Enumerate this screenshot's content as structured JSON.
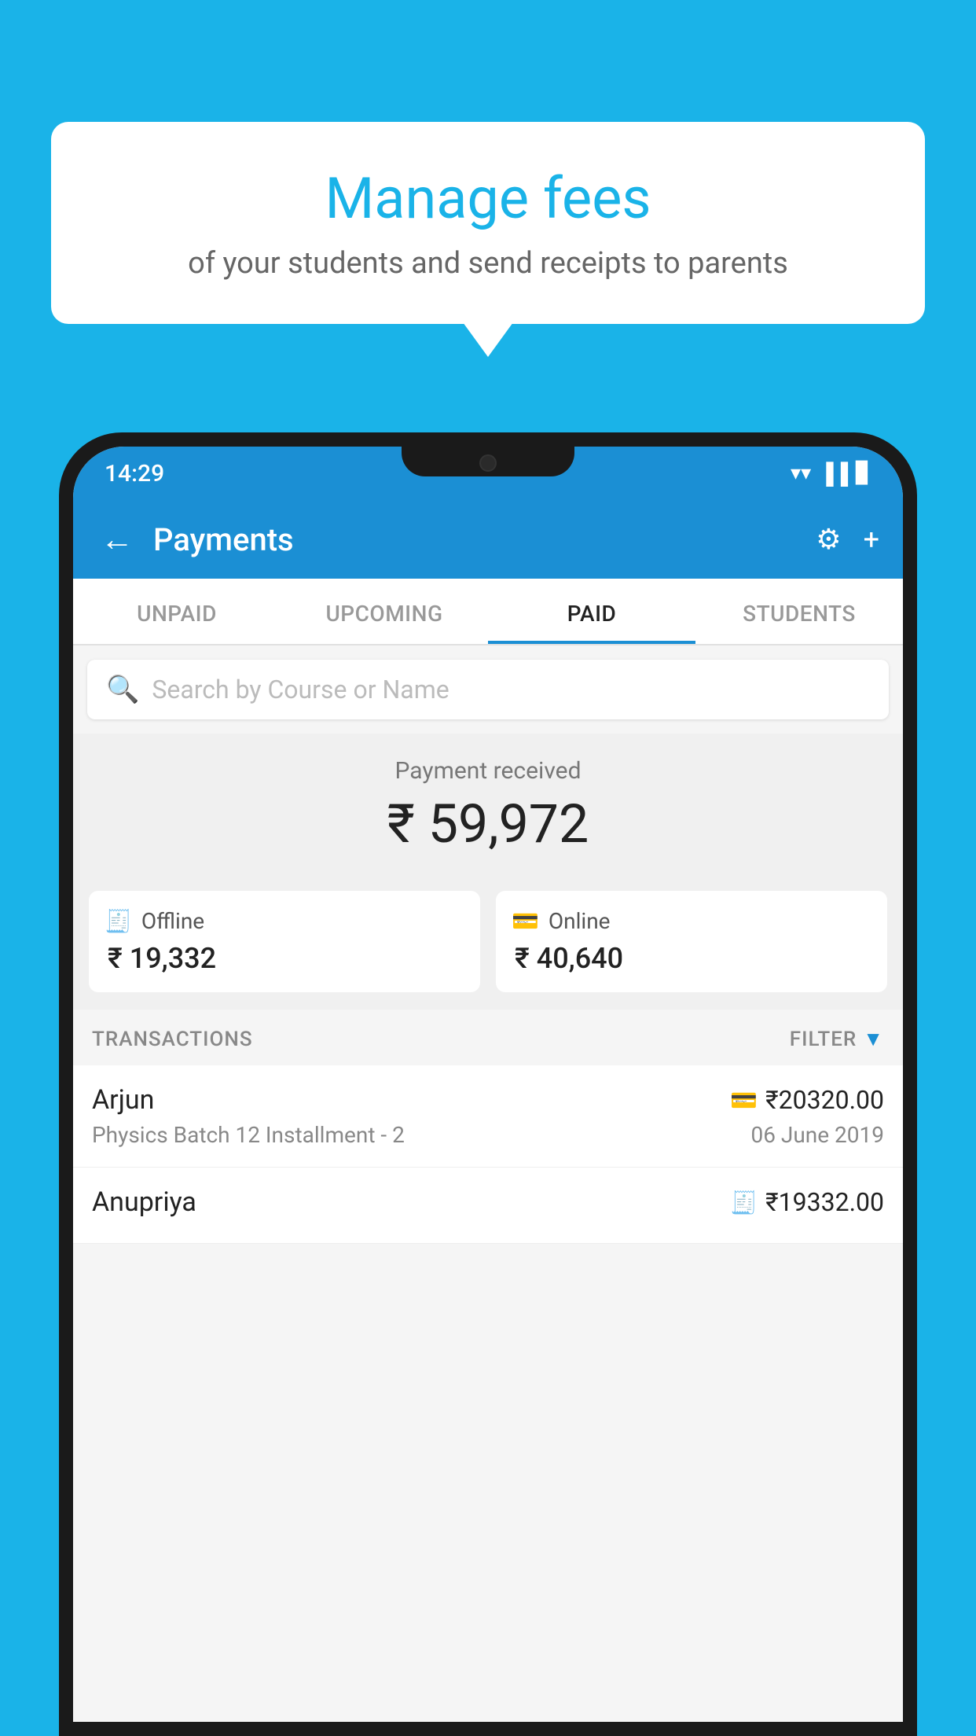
{
  "background_color": "#1ab3e8",
  "speech_bubble": {
    "title": "Manage fees",
    "subtitle": "of your students and send receipts to parents"
  },
  "status_bar": {
    "time": "14:29",
    "wifi": "▲",
    "signal": "▲",
    "battery": "▊"
  },
  "header": {
    "title": "Payments",
    "back_label": "←",
    "gear_label": "⚙",
    "plus_label": "+"
  },
  "tabs": [
    {
      "id": "unpaid",
      "label": "UNPAID",
      "active": false
    },
    {
      "id": "upcoming",
      "label": "UPCOMING",
      "active": false
    },
    {
      "id": "paid",
      "label": "PAID",
      "active": true
    },
    {
      "id": "students",
      "label": "STUDENTS",
      "active": false
    }
  ],
  "search": {
    "placeholder": "Search by Course or Name"
  },
  "payment_summary": {
    "label": "Payment received",
    "amount": "₹ 59,972",
    "offline_label": "Offline",
    "offline_amount": "₹ 19,332",
    "online_label": "Online",
    "online_amount": "₹ 40,640"
  },
  "transactions_header": {
    "label": "TRANSACTIONS",
    "filter_label": "FILTER"
  },
  "transactions": [
    {
      "name": "Arjun",
      "method_icon": "card",
      "amount": "₹20320.00",
      "course": "Physics Batch 12 Installment - 2",
      "date": "06 June 2019"
    },
    {
      "name": "Anupriya",
      "method_icon": "cash",
      "amount": "₹19332.00",
      "course": "",
      "date": ""
    }
  ]
}
